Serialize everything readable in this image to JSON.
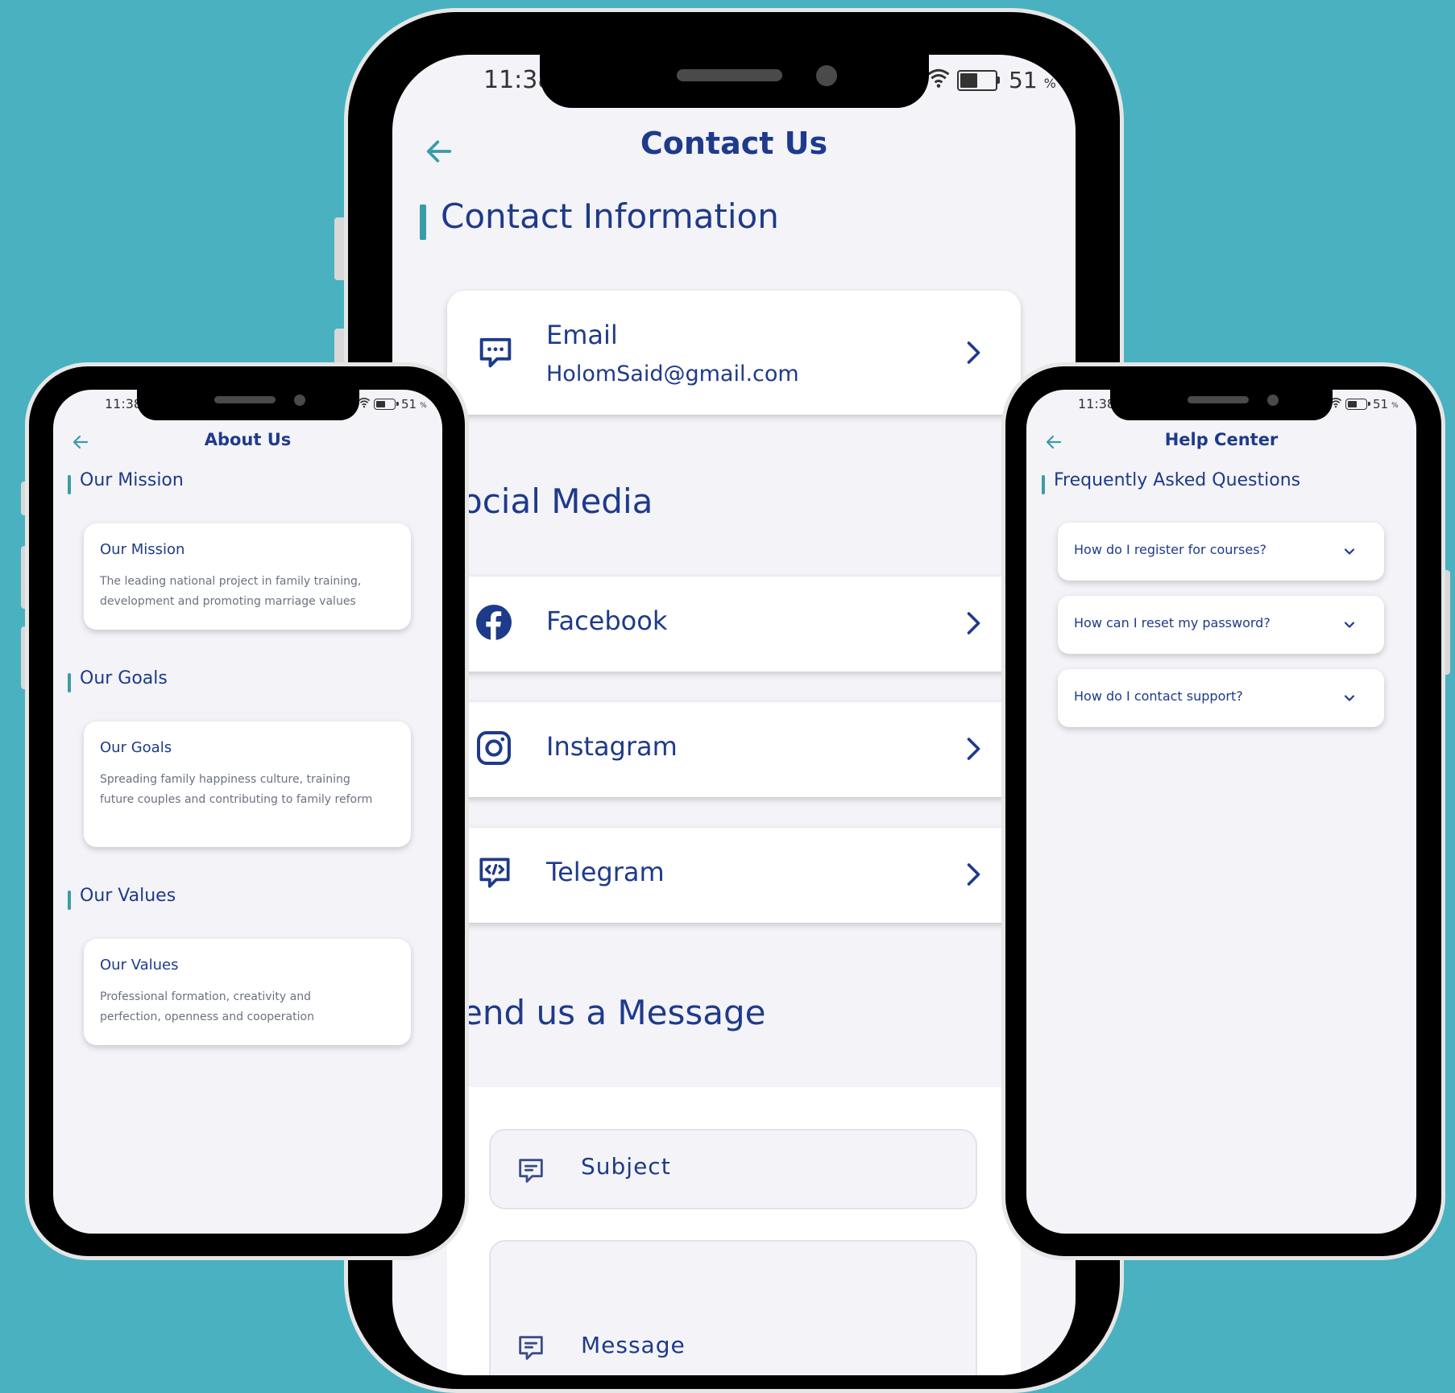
{
  "status": {
    "time": "11:38",
    "battery": "51",
    "battery_unit": "%"
  },
  "contact": {
    "title": "Contact Us",
    "section_info": "Contact Information",
    "email_label": "Email",
    "email_value": "HolomSaid@gmail.com",
    "section_social": "ocial Media",
    "facebook": "Facebook",
    "instagram": "Instagram",
    "telegram": "Telegram",
    "section_message": "end us a Message",
    "subject_placeholder": "Subject",
    "message_placeholder": "Message"
  },
  "about": {
    "title": "About Us",
    "sections": [
      {
        "heading": "Our Mission",
        "card_title": "Our Mission",
        "card_text": "The leading national project in family training, development and promoting marriage values"
      },
      {
        "heading": "Our Goals",
        "card_title": "Our Goals",
        "card_text": "Spreading family happiness culture, training future couples and contributing to family reform"
      },
      {
        "heading": "Our Values",
        "card_title": "Our Values",
        "card_text": "Professional formation, creativity and perfection, openness and cooperation"
      }
    ]
  },
  "help": {
    "title": "Help Center",
    "section": "Frequently Asked Questions",
    "faqs": [
      "How do I register for courses?",
      "How can I reset my password?",
      "How do I contact support?"
    ]
  },
  "colors": {
    "background": "#49b1c0",
    "navy": "#1e3a8a",
    "accent": "#3a9ca8",
    "screen": "#f3f3f8"
  }
}
